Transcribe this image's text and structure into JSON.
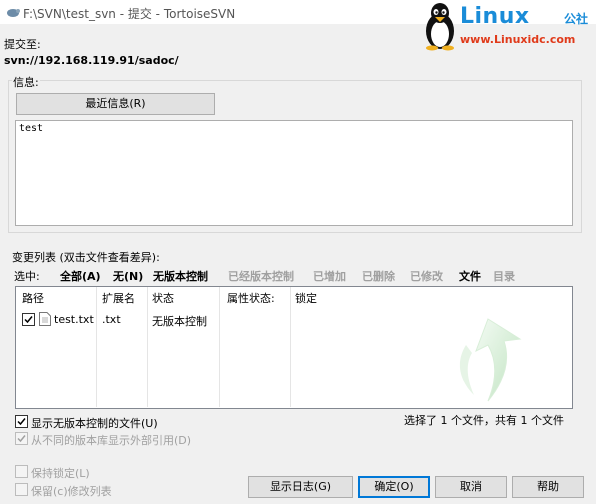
{
  "window": {
    "title": "F:\\SVN\\test_svn - 提交 - TortoiseSVN"
  },
  "watermark": {
    "brand": "Linux",
    "brand_cn": "公社",
    "url": "www.Linuxidc.com"
  },
  "commit": {
    "to_label": "提交至:",
    "url": "svn://192.168.119.91/sadoc/"
  },
  "message": {
    "group_label": "信息:",
    "recent_button": "最近信息(R)",
    "text": "test"
  },
  "changes": {
    "group_label": "变更列表 (双击文件查看差异):",
    "select_label": "选中:",
    "filters": [
      {
        "label": "全部(A)",
        "enabled": true
      },
      {
        "label": "无(N)",
        "enabled": true
      },
      {
        "label": "无版本控制",
        "enabled": true
      },
      {
        "label": "已经版本控制",
        "enabled": false
      },
      {
        "label": "已增加",
        "enabled": false
      },
      {
        "label": "已删除",
        "enabled": false
      },
      {
        "label": "已修改",
        "enabled": false
      },
      {
        "label": "文件",
        "enabled": true
      },
      {
        "label": "目录",
        "enabled": false
      }
    ],
    "columns": [
      "路径",
      "扩展名",
      "状态",
      "属性状态:",
      "锁定"
    ],
    "rows": [
      {
        "checked": true,
        "path": "test.txt",
        "ext": ".txt",
        "status": "无版本控制"
      }
    ]
  },
  "options": {
    "show_unversioned": "显示无版本控制的文件(U)",
    "show_externals": "从不同的版本库显示外部引用(D)",
    "selection_summary": "选择了 1 个文件，共有 1 个文件",
    "keep_locks": "保持锁定(L)",
    "keep_changelists": "保留(c)修改列表"
  },
  "buttons": {
    "show_log": "显示日志(G)",
    "ok": "确定(O)",
    "cancel": "取消",
    "help": "帮助"
  }
}
